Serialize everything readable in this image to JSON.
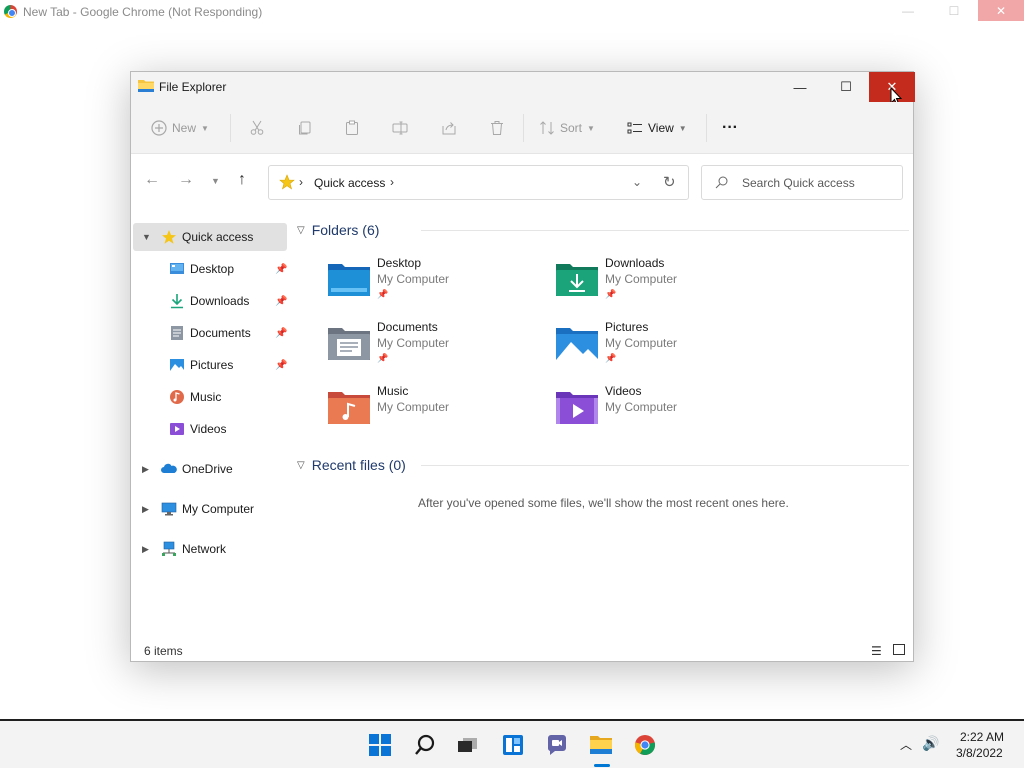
{
  "chrome": {
    "title": "New Tab - Google Chrome (Not Responding)",
    "minimize": "—",
    "maximize": "☐",
    "close": "✕"
  },
  "explorer": {
    "title": "File Explorer",
    "window": {
      "minimize": "—",
      "maximize": "☐",
      "close": "✕"
    },
    "toolbar": {
      "new_label": "New",
      "sort_label": "Sort",
      "view_label": "View",
      "more_label": "···"
    },
    "address": {
      "path_label": "Quick access",
      "separator": "›"
    },
    "search": {
      "placeholder": "Search Quick access"
    },
    "sidebar": {
      "quick_access": "Quick access",
      "pinned": [
        {
          "label": "Desktop",
          "icon": "desktop-icon",
          "pinned": true
        },
        {
          "label": "Downloads",
          "icon": "downloads-icon",
          "pinned": true
        },
        {
          "label": "Documents",
          "icon": "documents-icon",
          "pinned": true
        },
        {
          "label": "Pictures",
          "icon": "pictures-icon",
          "pinned": true
        },
        {
          "label": "Music",
          "icon": "music-icon",
          "pinned": false
        },
        {
          "label": "Videos",
          "icon": "videos-icon",
          "pinned": false
        }
      ],
      "onedrive": "OneDrive",
      "my_computer": "My Computer",
      "network": "Network"
    },
    "folders_header": "Folders (6)",
    "folders": [
      {
        "name": "Desktop",
        "location": "My Computer",
        "pinned": true,
        "color": "#1e90d8"
      },
      {
        "name": "Downloads",
        "location": "My Computer",
        "pinned": true,
        "color": "#1ba37a"
      },
      {
        "name": "Documents",
        "location": "My Computer",
        "pinned": true,
        "color": "#8d96a3"
      },
      {
        "name": "Pictures",
        "location": "My Computer",
        "pinned": true,
        "color": "#2d8fe0"
      },
      {
        "name": "Music",
        "location": "My Computer",
        "pinned": false,
        "color": "#e06a4a"
      },
      {
        "name": "Videos",
        "location": "My Computer",
        "pinned": false,
        "color": "#8a4fd6"
      }
    ],
    "recent_header": "Recent files (0)",
    "recent_empty": "After you've opened some files, we'll show the most recent ones here.",
    "status": "6 items"
  },
  "taskbar": {
    "time": "2:22 AM",
    "date": "3/8/2022",
    "apps": [
      "start-icon",
      "search-icon",
      "task-view-icon",
      "widgets-icon",
      "chat-icon",
      "file-explorer-icon",
      "chrome-icon"
    ]
  },
  "colors": {
    "close_red": "#c42b1c",
    "accent_blue": "#0078d4",
    "folder_yellow": "#f5c542"
  }
}
